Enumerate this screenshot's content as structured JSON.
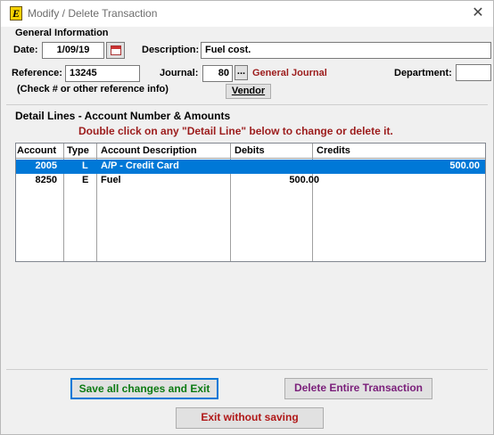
{
  "window": {
    "title": "Modify / Delete Transaction",
    "app_icon_letter": "E",
    "close_glyph": "✕"
  },
  "general": {
    "header": "General Information",
    "date_label": "Date:",
    "date_value": "1/09/19",
    "description_label": "Description:",
    "description_value": "Fuel cost.",
    "reference_label": "Reference:",
    "reference_value": "13245",
    "reference_hint": "(Check # or other reference info)",
    "journal_label": "Journal:",
    "journal_value": "80",
    "journal_lookup_label": "...",
    "journal_name": "General Journal",
    "department_label": "Department:",
    "department_value": "",
    "vendor_button": "Vendor"
  },
  "detail": {
    "header": "Detail Lines - Account Number & Amounts",
    "hint": "Double click on any \"Detail Line\" below to change or delete it.",
    "columns": [
      "Account",
      "Type",
      "Account Description",
      "Debits",
      "Credits"
    ],
    "rows": [
      {
        "account": "2005",
        "type": "L",
        "description": "A/P - Credit Card",
        "debits": "",
        "credits": "500.00",
        "selected": true
      },
      {
        "account": "8250",
        "type": "E",
        "description": "Fuel",
        "debits": "500.00",
        "credits": "",
        "selected": false
      }
    ]
  },
  "buttons": {
    "save": "Save all changes and Exit",
    "delete": "Delete Entire Transaction",
    "exit": "Exit without saving"
  },
  "colors": {
    "selection": "#0078d7",
    "journal_name": "#9c1c1c",
    "save_text": "#0b7a12",
    "delete_text": "#7a1f7a",
    "exit_text": "#b01818"
  },
  "icons": {
    "app": "app-logo-icon",
    "calendar": "calendar-icon",
    "close": "close-icon"
  }
}
